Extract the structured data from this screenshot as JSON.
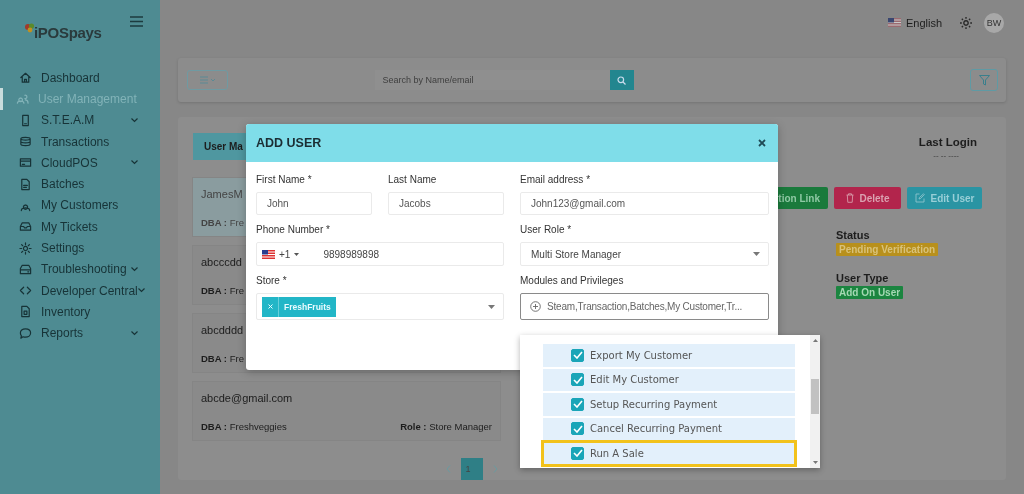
{
  "sidebar": {
    "logo": "iPOSpays",
    "items": [
      {
        "label": "Dashboard",
        "selected": false,
        "expandable": false
      },
      {
        "label": "User Management",
        "selected": true,
        "expandable": false
      },
      {
        "label": "S.T.E.A.M",
        "selected": false,
        "expandable": true
      },
      {
        "label": "Transactions",
        "selected": false,
        "expandable": false
      },
      {
        "label": "CloudPOS",
        "selected": false,
        "expandable": true
      },
      {
        "label": "Batches",
        "selected": false,
        "expandable": false
      },
      {
        "label": "My Customers",
        "selected": false,
        "expandable": false
      },
      {
        "label": "My Tickets",
        "selected": false,
        "expandable": false
      },
      {
        "label": "Settings",
        "selected": false,
        "expandable": false
      },
      {
        "label": "Troubleshooting",
        "selected": false,
        "expandable": true
      },
      {
        "label": "Developer Central",
        "selected": false,
        "expandable": true
      },
      {
        "label": "Inventory",
        "selected": false,
        "expandable": false
      },
      {
        "label": "Reports",
        "selected": false,
        "expandable": true
      }
    ]
  },
  "topbar": {
    "language": "English",
    "avatar": "BW"
  },
  "toolbar": {
    "search_placeholder": "Search by Name/email"
  },
  "list": {
    "tab": "User Ma",
    "last_login_label": "Last Login",
    "last_login_value": "-- -- ----",
    "rows": [
      {
        "email": "JamesM",
        "dba": "**DBA :** Fre",
        "selected": true
      },
      {
        "email": "abcccdd",
        "dba": "**DBA :** Fre",
        "selected": false
      },
      {
        "email": "abcdddd",
        "dba": "**DBA :** Fre",
        "selected": false
      },
      {
        "email": "abcde@gmail.com",
        "dba": "**DBA :** Freshveggies",
        "role": "**Role :** Store Manager",
        "selected": false
      }
    ],
    "actions": [
      {
        "label": "tion Link",
        "kind": "link"
      },
      {
        "label": "Delete",
        "kind": "delete"
      },
      {
        "label": "Edit User",
        "kind": "edit"
      }
    ],
    "status_label": "Status",
    "status": "Pending Verification",
    "user_type_label": "User Type",
    "user_type": "Add On User",
    "pages": [
      {
        "label": "1",
        "selected": true
      }
    ]
  },
  "modal": {
    "title": "ADD USER",
    "first_name": {
      "label": "First Name *",
      "value": "John"
    },
    "last_name": {
      "label": "Last Name",
      "value": "Jacobs"
    },
    "email": {
      "label": "Email address *",
      "value": "John123@gmail.com"
    },
    "phone": {
      "label": "Phone Number *",
      "country_code": "+1",
      "value": "9898989898"
    },
    "user_role": {
      "label": "User Role *",
      "value": "Multi Store Manager"
    },
    "store": {
      "label": "Store *",
      "tags": [
        "FreshFruits"
      ]
    },
    "modules": {
      "label": "Modules and Privileges",
      "value": "Steam,Transaction,Batches,My Customer,Tr..."
    }
  },
  "dropdown": {
    "items": [
      {
        "label": "Export My Customer",
        "checked": true,
        "highlighted": false
      },
      {
        "label": "Edit My Customer",
        "checked": true,
        "highlighted": false
      },
      {
        "label": "Setup Recurring Payment",
        "checked": true,
        "highlighted": false
      },
      {
        "label": "Cancel Recurring Payment",
        "checked": true,
        "highlighted": false
      },
      {
        "label": "Run A Sale",
        "checked": true,
        "highlighted": true
      }
    ]
  }
}
